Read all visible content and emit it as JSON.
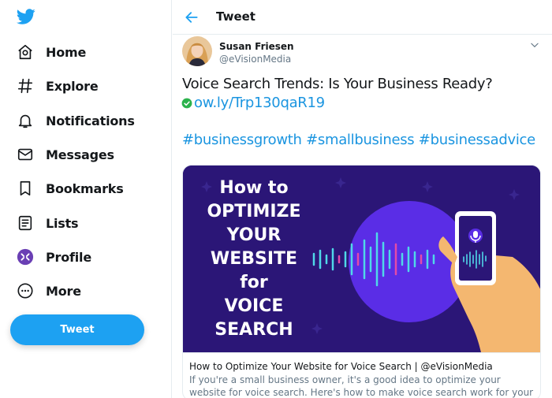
{
  "nav": {
    "items": [
      {
        "label": "Home",
        "icon": "home-icon"
      },
      {
        "label": "Explore",
        "icon": "hashtag-icon"
      },
      {
        "label": "Notifications",
        "icon": "bell-icon"
      },
      {
        "label": "Messages",
        "icon": "envelope-icon"
      },
      {
        "label": "Bookmarks",
        "icon": "bookmark-icon"
      },
      {
        "label": "Lists",
        "icon": "list-icon"
      },
      {
        "label": "Profile",
        "icon": "avatar-icon"
      },
      {
        "label": "More",
        "icon": "more-icon"
      }
    ],
    "tweet_button": "Tweet"
  },
  "header": {
    "title": "Tweet"
  },
  "tweet": {
    "author_name": "Susan Friesen",
    "author_handle": "@eVisionMedia",
    "text": "Voice Search Trends: Is Your Business Ready?",
    "link": "ow.ly/Trp130qaR19",
    "hashtags": [
      "#businessgrowth",
      "#smallbusiness",
      "#businessadvice"
    ]
  },
  "card": {
    "image_lines": [
      "How to",
      "OPTIMIZE",
      "YOUR",
      "WEBSITE",
      "for",
      "VOICE",
      "SEARCH"
    ],
    "title": "How to Optimize Your Website for Voice Search | @eVisionMedia",
    "description": "If you're a small business owner, it's a good idea to optimize your website for voice search. Here's how to make voice search work for your business:"
  },
  "colors": {
    "brand_blue": "#1da1f2",
    "link_blue": "#1b95e0",
    "card_bg": "#2b1677",
    "circle": "#5a2de6",
    "check_green": "#2bb24c"
  }
}
